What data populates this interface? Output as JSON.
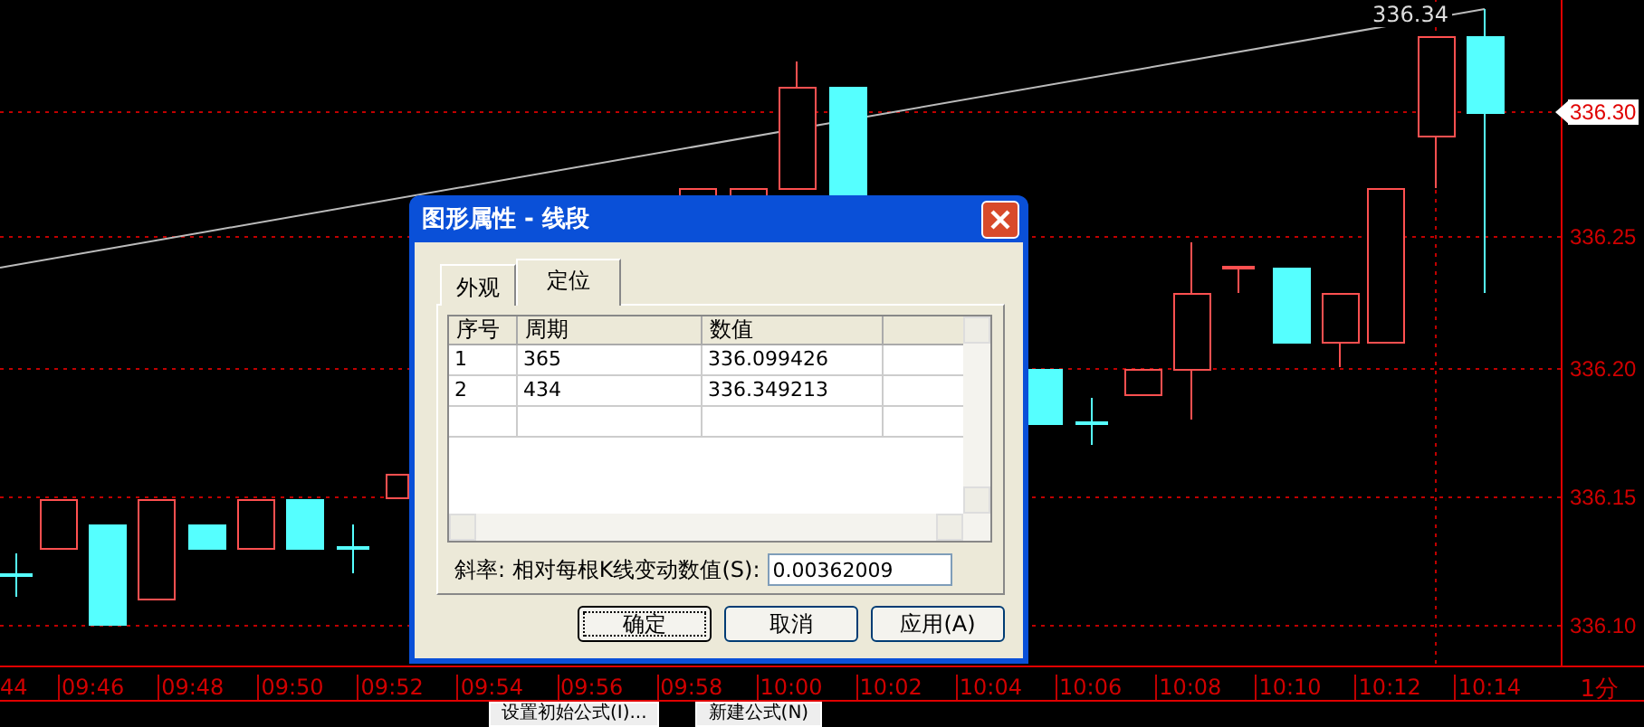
{
  "chart": {
    "price_label": "336.34",
    "y_labels": [
      {
        "text": "336.30",
        "current": true
      },
      {
        "text": "336.25",
        "current": false
      },
      {
        "text": "336.20",
        "current": false
      },
      {
        "text": "336.15",
        "current": false
      },
      {
        "text": "336.10",
        "current": false
      }
    ],
    "time_labels": [
      "44",
      "09:46",
      "09:48",
      "09:50",
      "09:52",
      "09:54",
      "09:56",
      "09:58",
      "10:00",
      "10:02",
      "10:04",
      "10:06",
      "10:08",
      "10:10",
      "10:12",
      "10:14"
    ],
    "period": "1分"
  },
  "dialog": {
    "title": "图形属性 - 线段",
    "tabs": [
      {
        "label": "外观",
        "selected": false
      },
      {
        "label": "定位",
        "selected": true
      }
    ],
    "columns": [
      "序号",
      "周期",
      "数值"
    ],
    "rows": [
      [
        "1",
        "365",
        "336.099426"
      ],
      [
        "2",
        "434",
        "336.349213"
      ]
    ],
    "slope_label": "斜率: 相对每根K线变动数值(S):",
    "slope_value": "0.00362009",
    "buttons": [
      {
        "label": "确定",
        "default": true
      },
      {
        "label": "取消",
        "default": false
      },
      {
        "label": "应用(A)",
        "default": false
      }
    ]
  },
  "bottom_buttons": [
    "设置初始公式(I)...",
    "新建公式(N)"
  ]
}
